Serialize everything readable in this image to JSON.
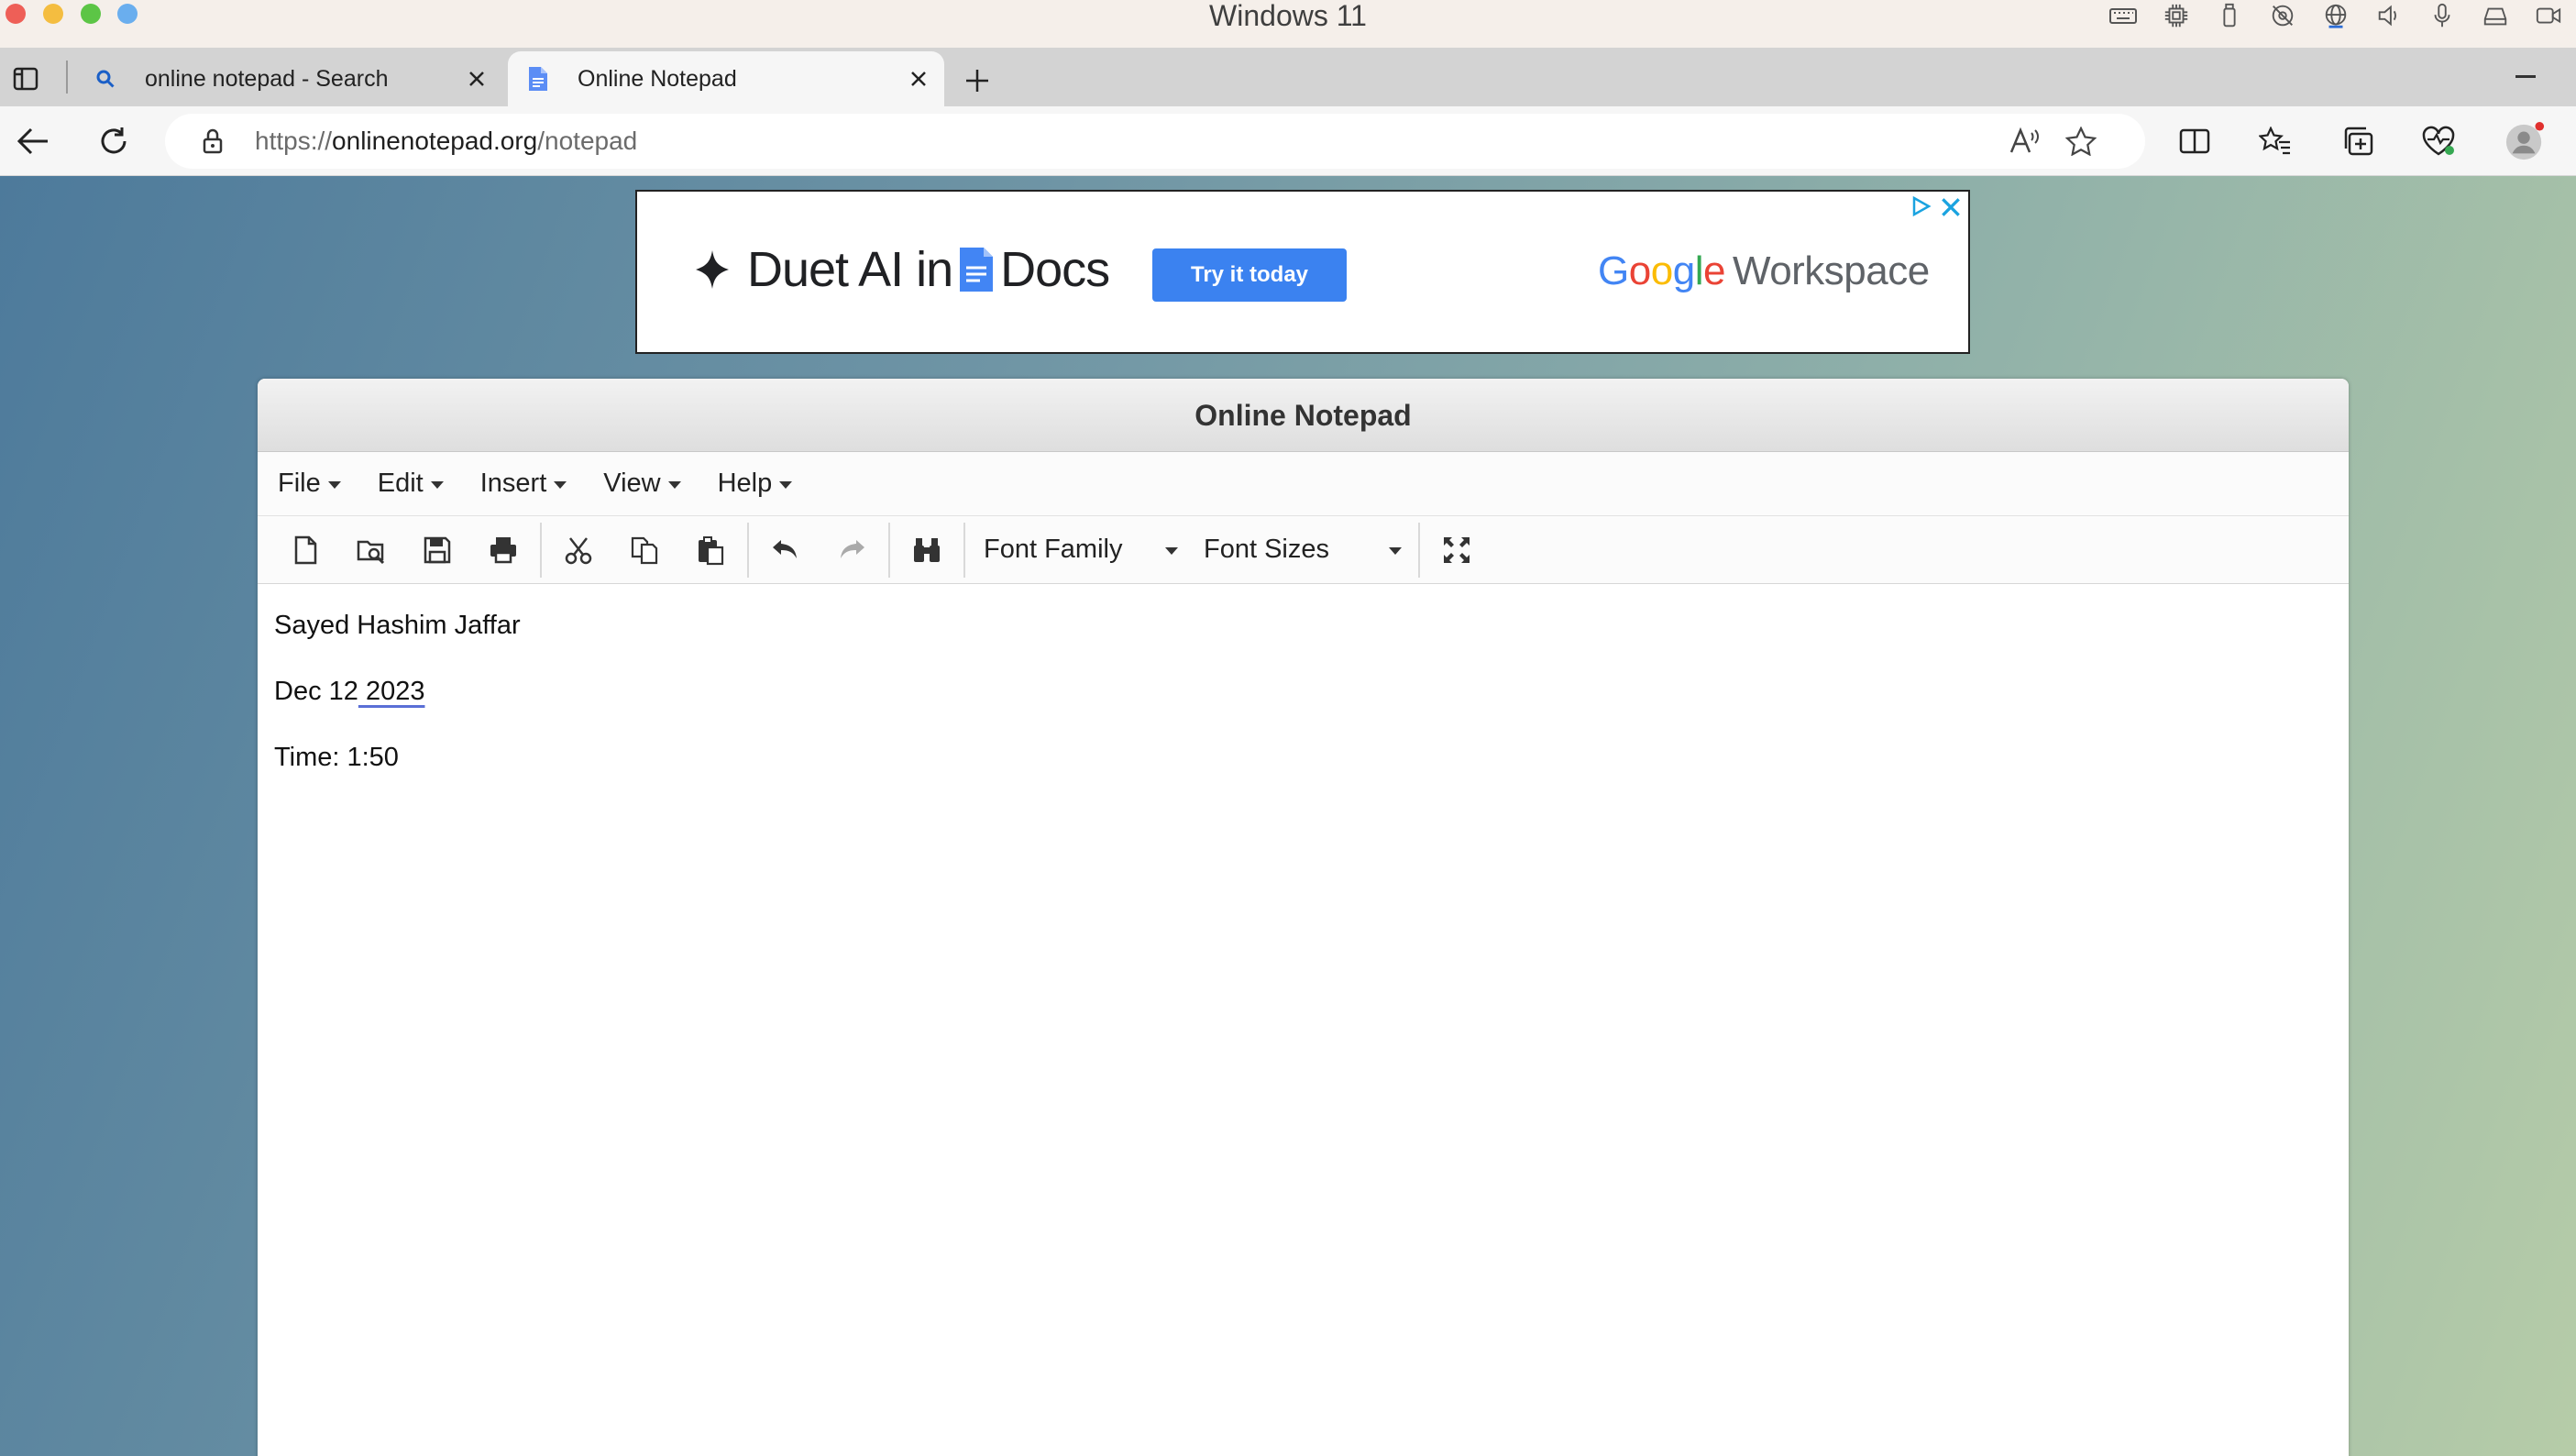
{
  "os": {
    "window_title": "Windows 11"
  },
  "browser": {
    "tabs": [
      {
        "label": "online notepad - Search",
        "active": false
      },
      {
        "label": "Online Notepad",
        "active": true
      }
    ],
    "url": {
      "scheme": "https://",
      "host": "onlinenotepad.org",
      "path": "/notepad"
    }
  },
  "ad": {
    "headline_part1": "Duet AI in",
    "headline_part2": "Docs",
    "cta": "Try it today",
    "brand_letters": [
      "G",
      "o",
      "o",
      "g",
      "l",
      "e"
    ],
    "brand_suffix": "Workspace"
  },
  "notepad": {
    "title": "Online Notepad",
    "menu": [
      "File",
      "Edit",
      "Insert",
      "View",
      "Help"
    ],
    "font_family_label": "Font Family",
    "font_sizes_label": "Font Sizes",
    "lines": {
      "line1": "Sayed Hashim Jaffar",
      "line2_a": "Dec 12",
      "line2_b": " 2023",
      "line3": "Time: 1:50"
    }
  },
  "colors": {
    "ad_button": "#3b82f0",
    "page_gradient_start": "#4d7a9b",
    "page_gradient_end": "#b6cca8"
  }
}
